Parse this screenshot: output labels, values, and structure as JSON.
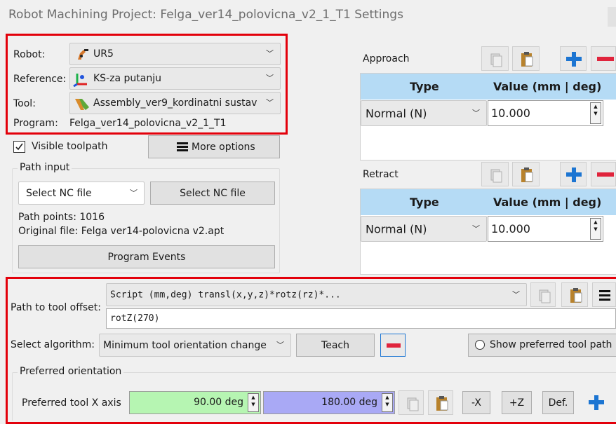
{
  "window": {
    "title": "Robot Machining Project: Felga_ver14_polovicna_v2_1_T1 Settings"
  },
  "setup": {
    "robot_label": "Robot:",
    "robot_value": "UR5",
    "reference_label": "Reference:",
    "reference_value": "KS-za putanju",
    "tool_label": "Tool:",
    "tool_value": "Assembly_ver9_kordinatni sustav",
    "program_label": "Program:",
    "program_value": "Felga_ver14_polovicna_v2_1_T1"
  },
  "options": {
    "visible_toolpath_label": "Visible toolpath",
    "visible_toolpath_checked": true,
    "more_options_label": "More options"
  },
  "path_input": {
    "group_label": "Path input",
    "select_value": "Select NC file",
    "select_button": "Select NC file",
    "path_points": "Path points: 1016",
    "original_file": "Original file: Felga ver14-polovicna v2.apt",
    "program_events": "Program Events"
  },
  "approach": {
    "label": "Approach",
    "header_type": "Type",
    "header_value": "Value (mm | deg)",
    "type_value": "Normal (N)",
    "value": "10.000"
  },
  "retract": {
    "label": "Retract",
    "header_type": "Type",
    "header_value": "Value (mm | deg)",
    "type_value": "Normal (N)",
    "value": "10.000"
  },
  "offset": {
    "label": "Path to tool offset:",
    "script_value": "Script (mm,deg) transl(x,y,z)*rotz(rz)*...",
    "expression": "rotZ(270)"
  },
  "algorithm": {
    "label": "Select algorithm:",
    "value": "Minimum tool orientation change",
    "teach": "Teach",
    "show_preferred": "Show preferred tool path"
  },
  "preferred": {
    "group_label": "Preferred orientation",
    "x_axis_label": "Preferred tool X axis",
    "value1": "90.00 deg",
    "value2": "180.00 deg",
    "btn_minus_x": "-X",
    "btn_plus_z": "+Z",
    "btn_def": "Def."
  },
  "colors": {
    "highlight": "#e3000b",
    "header_blue": "#b5dbf5",
    "plus_blue": "#1c75d2",
    "minus_red": "#e0243c",
    "value_green": "#b6f5b2",
    "value_purple": "#a9a9f5"
  },
  "icons": [
    "robot-icon",
    "reference-frame-icon",
    "tool-icon",
    "hamburger-icon",
    "copy-icon",
    "paste-icon",
    "plus-icon",
    "minus-icon",
    "chevron-down-icon"
  ]
}
